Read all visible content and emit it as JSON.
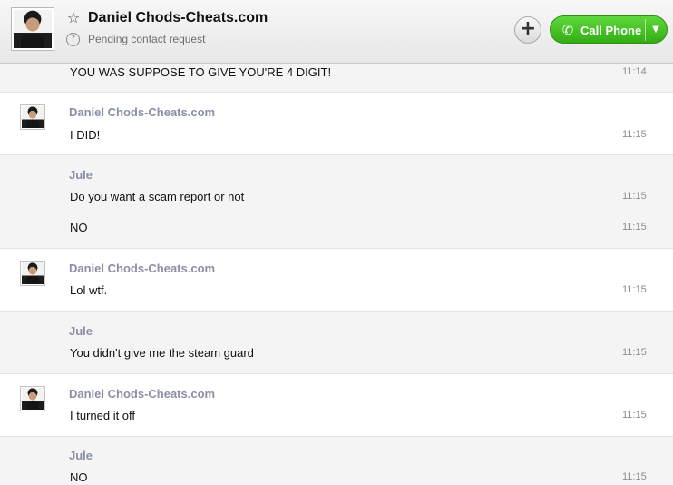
{
  "header": {
    "contact_name": "Daniel Chods-Cheats.com",
    "status": "Pending contact request",
    "call_label": "Call Phone",
    "call_color": "#3cbf1e"
  },
  "messages": [
    {
      "text": "YOU WAS SUPPOSE TO GIVE YOU'RE 4 DIGIT!",
      "time": "11:14"
    },
    {
      "sender": "Daniel Chods-Cheats.com",
      "text": "I DID!",
      "time": "11:15"
    },
    {
      "sender": "Jule",
      "text": "Do you want a scam report or not",
      "time": "11:15"
    },
    {
      "text": "NO",
      "time": "11:15"
    },
    {
      "sender": "Daniel Chods-Cheats.com",
      "text": "Lol wtf.",
      "time": "11:15"
    },
    {
      "sender": "Jule",
      "text": "You didn't give me the steam guard",
      "time": "11:15"
    },
    {
      "sender": "Daniel Chods-Cheats.com",
      "text": "I turned it off",
      "time": "11:15"
    },
    {
      "sender": "Jule",
      "text": "NO",
      "time": "11:15"
    }
  ]
}
